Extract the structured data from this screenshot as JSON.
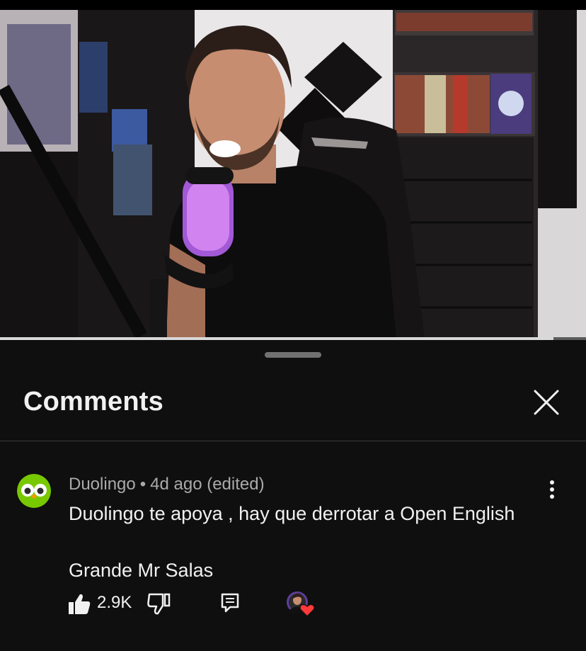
{
  "video": {
    "progress": 0.945
  },
  "comments_panel": {
    "title": "Comments",
    "comment": {
      "author": "Duolingo",
      "separator": "•",
      "time": "4d ago (edited)",
      "text": "Duolingo te apoya , hay que derrotar a Open English\n\nGrande Mr Salas",
      "likes": "2.9K"
    }
  },
  "colors": {
    "background": "#0f0f0f",
    "text_primary": "#f1f1f1",
    "text_secondary": "#aaaaaa",
    "duolingo_green": "#78c800",
    "heart_red": "#ff3a3a"
  },
  "icons": {
    "close": "close-icon",
    "more": "more-vertical-icon",
    "like": "thumbs-up-icon",
    "dislike": "thumbs-down-icon",
    "reply": "reply-icon",
    "creator_heart": "creator-heart-icon"
  }
}
